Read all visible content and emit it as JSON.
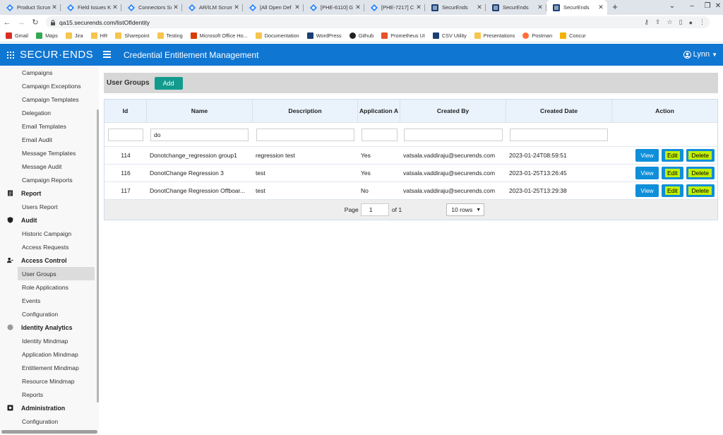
{
  "browser": {
    "tabs": [
      {
        "title": "Product Scrum",
        "icon": "jira-icon"
      },
      {
        "title": "Field Issues Ka",
        "icon": "jira-icon"
      },
      {
        "title": "Connectors Sc",
        "icon": "jira-icon"
      },
      {
        "title": "AR/ILM Scrum",
        "icon": "jira-icon"
      },
      {
        "title": "[All Open Def",
        "icon": "jira-icon"
      },
      {
        "title": "[PHE-6110] G",
        "icon": "jira-icon"
      },
      {
        "title": "[PHE-7217] C",
        "icon": "jira-icon"
      },
      {
        "title": "SecurEnds",
        "icon": "securends-icon"
      },
      {
        "title": "SecurEnds",
        "icon": "securends-icon"
      },
      {
        "title": "SecurEnds",
        "icon": "securends-icon",
        "active": true
      }
    ],
    "url": "qa15.securends.com/listOfIdentity",
    "bookmarks": [
      {
        "label": "Gmail",
        "icon": "gmail-icon"
      },
      {
        "label": "Maps",
        "icon": "maps-icon"
      },
      {
        "label": "Jira",
        "icon": "folder-icon"
      },
      {
        "label": "HR",
        "icon": "folder-icon"
      },
      {
        "label": "Sharepoint",
        "icon": "folder-icon"
      },
      {
        "label": "Testing",
        "icon": "folder-icon"
      },
      {
        "label": "Microsoft Office Ho...",
        "icon": "office-icon"
      },
      {
        "label": "Documentation",
        "icon": "folder-icon"
      },
      {
        "label": "WordPress",
        "icon": "securends-icon"
      },
      {
        "label": "Github",
        "icon": "github-icon"
      },
      {
        "label": "Prometheus UI",
        "icon": "prometheus-icon"
      },
      {
        "label": "CSV Utility",
        "icon": "securends-icon"
      },
      {
        "label": "Presentations",
        "icon": "folder-icon"
      },
      {
        "label": "Postman",
        "icon": "postman-icon"
      },
      {
        "label": "Concur",
        "icon": "concur-icon"
      }
    ]
  },
  "header": {
    "logo": "SECUR·ENDS",
    "title": "Credential Entitlement Management",
    "user": "Lynn"
  },
  "sidebar": {
    "top_items": [
      "Campaigns",
      "Campaign Exceptions",
      "Campaign Templates",
      "Delegation",
      "Email Templates",
      "Email Audit",
      "Message Templates",
      "Message Audit",
      "Campaign Reports"
    ],
    "sections": [
      {
        "title": "Report",
        "icon": "report-icon",
        "items": [
          "Users Report"
        ]
      },
      {
        "title": "Audit",
        "icon": "shield-icon",
        "items": [
          "Historic Campaign",
          "Access Requests"
        ]
      },
      {
        "title": "Access Control",
        "icon": "user-key-icon",
        "items": [
          "User Groups",
          "Role Applications",
          "Events",
          "Configuration"
        ]
      },
      {
        "title": "Identity Analytics",
        "icon": "analytics-icon",
        "items": [
          "Identity Mindmap",
          "Application Mindmap",
          "Entitlement Mindmap",
          "Resource Mindmap",
          "Reports"
        ]
      },
      {
        "title": "Administration",
        "icon": "admin-icon",
        "items": [
          "Configuration"
        ]
      }
    ],
    "active_item": "User Groups"
  },
  "main": {
    "section_title": "User Groups",
    "add_label": "Add",
    "columns": [
      "Id",
      "Name",
      "Description",
      "Application A",
      "Created By",
      "Created Date",
      "Action"
    ],
    "filters": {
      "id": "",
      "name": "do",
      "description": "",
      "application": "",
      "created_by": "",
      "created_date": ""
    },
    "rows": [
      {
        "id": "114",
        "name": "Donotchange_regression group1",
        "description": "regression test",
        "application": "Yes",
        "created_by": "vatsala.vaddiraju@securends.com",
        "created_date": "2023-01-24T08:59:51"
      },
      {
        "id": "116",
        "name": "DonotChange Regression 3",
        "description": "test",
        "application": "Yes",
        "created_by": "vatsala.vaddiraju@securends.com",
        "created_date": "2023-01-25T13:26:45"
      },
      {
        "id": "117",
        "name": "DonotChange Regression Offboar...",
        "description": "test",
        "application": "No",
        "created_by": "vatsala.vaddiraju@securends.com",
        "created_date": "2023-01-25T13:29:38"
      }
    ],
    "actions": {
      "view": "View",
      "edit": "Edit",
      "delete": "Delete"
    },
    "pager": {
      "page_label": "Page",
      "page": "1",
      "of_label": "of 1",
      "rows_option": "10 rows"
    }
  },
  "colors": {
    "header_blue": "#0f76d2",
    "add_green": "#129b8d",
    "action_blue": "#0f8fd9",
    "highlight": "#c2f000"
  }
}
